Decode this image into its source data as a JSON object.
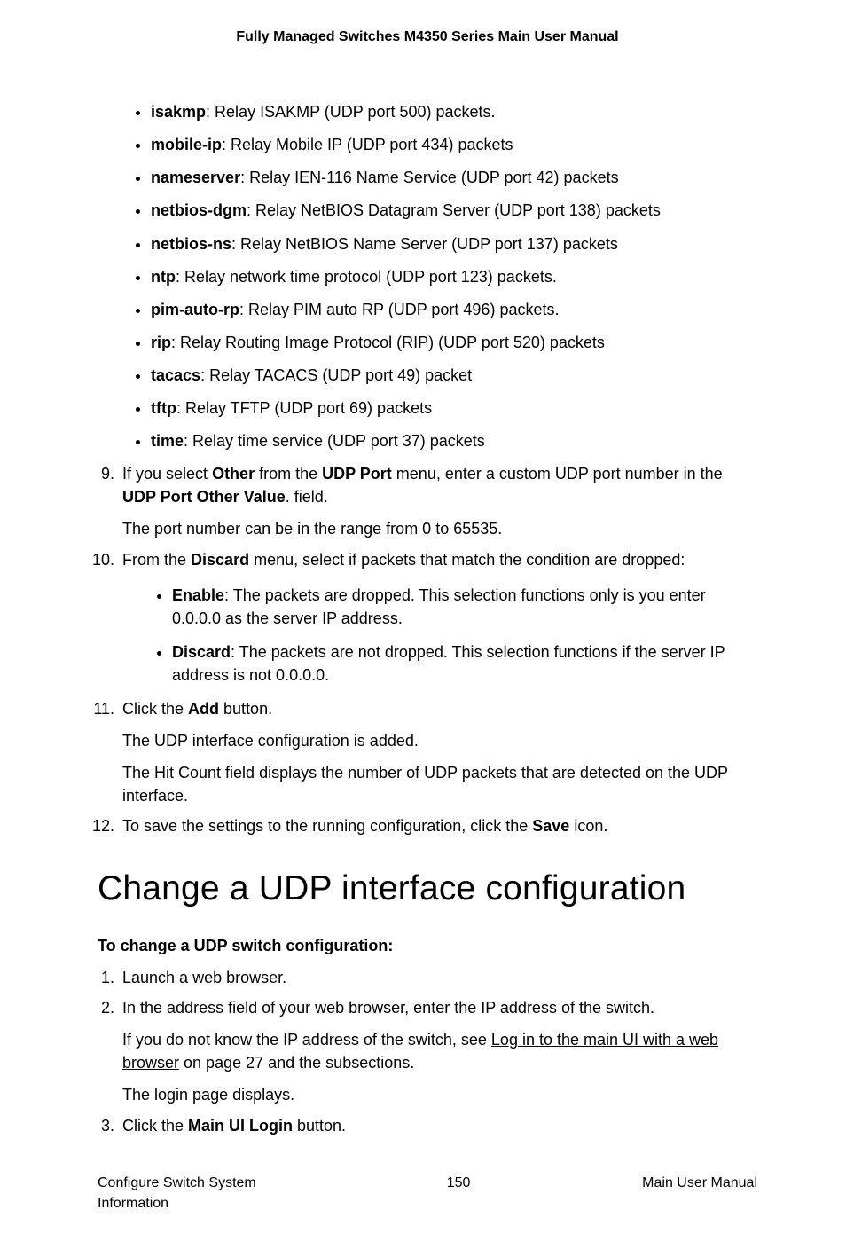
{
  "header": {
    "title": "Fully Managed Switches M4350 Series Main User Manual"
  },
  "relay_list": [
    {
      "term": "isakmp",
      "desc": ": Relay ISAKMP (UDP port 500) packets."
    },
    {
      "term": "mobile-ip",
      "desc": ": Relay Mobile IP (UDP port 434) packets"
    },
    {
      "term": "nameserver",
      "desc": ": Relay IEN-116 Name Service (UDP port 42) packets"
    },
    {
      "term": "netbios-dgm",
      "desc": ": Relay NetBIOS Datagram Server (UDP port 138) packets"
    },
    {
      "term": "netbios-ns",
      "desc": ": Relay NetBIOS Name Server (UDP port 137) packets"
    },
    {
      "term": "ntp",
      "desc": ": Relay network time protocol (UDP port 123) packets."
    },
    {
      "term": "pim-auto-rp",
      "desc": ": Relay PIM auto RP (UDP port 496) packets."
    },
    {
      "term": "rip",
      "desc": ": Relay Routing Image Protocol (RIP) (UDP port 520) packets"
    },
    {
      "term": "tacacs",
      "desc": ": Relay TACACS (UDP port 49) packet"
    },
    {
      "term": "tftp",
      "desc": ": Relay TFTP (UDP port 69) packets"
    },
    {
      "term": "time",
      "desc": ": Relay time service (UDP port 37) packets"
    }
  ],
  "step9": {
    "pre1": "If you select ",
    "b1": "Other",
    "mid1": " from the ",
    "b2": "UDP Port",
    "mid2": " menu, enter a custom UDP port number in the ",
    "b3": "UDP Port Other Value",
    "post1": ". field.",
    "note": "The port number can be in the range from 0 to 65535."
  },
  "step10": {
    "pre": "From the ",
    "b1": "Discard",
    "post": " menu, select if packets that match the condition are dropped:",
    "items": [
      {
        "term": "Enable",
        "desc": ": The packets are dropped. This selection functions only is you enter 0.0.0.0 as the server IP address."
      },
      {
        "term": "Discard",
        "desc": ": The packets are not dropped. This selection functions if the server IP address is not 0.0.0.0."
      }
    ]
  },
  "step11": {
    "pre": "Click the ",
    "b1": "Add",
    "post": " button.",
    "p1": "The UDP interface configuration is added.",
    "p2": "The Hit Count field displays the number of UDP packets that are detected on the UDP interface."
  },
  "step12": {
    "pre": "To save the settings to the running configuration, click the ",
    "b1": "Save",
    "post": " icon."
  },
  "section_heading": "Change a UDP interface configuration",
  "subheading": "To change a UDP switch configuration:",
  "change_steps": {
    "s1": "Launch a web browser.",
    "s2": {
      "line1": "In the address field of your web browser, enter the IP address of the switch.",
      "line2_pre": "If you do not know the IP address of the switch, see ",
      "line2_link": "Log in to the main UI with a web browser",
      "line2_post": " on page 27 and the subsections.",
      "line3": "The login page displays."
    },
    "s3": {
      "pre": "Click the ",
      "b1": "Main UI Login",
      "post": " button."
    }
  },
  "footer": {
    "left": "Configure Switch System Information",
    "center": "150",
    "right": "Main User Manual"
  }
}
